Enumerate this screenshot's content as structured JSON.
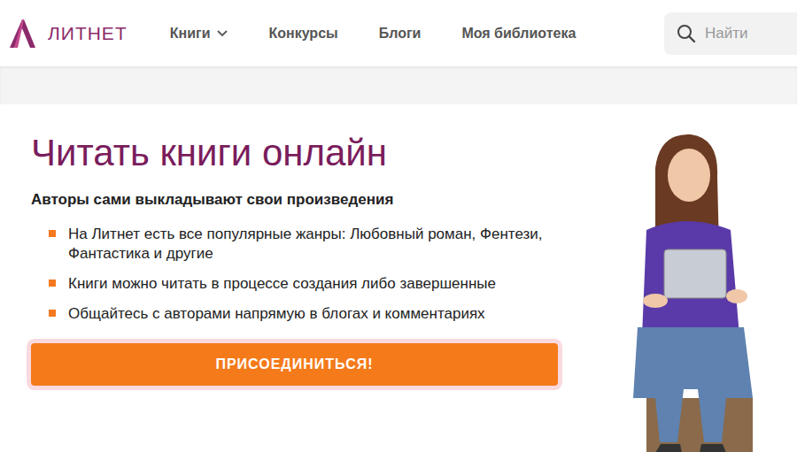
{
  "logo": {
    "text": "ЛИТНЕТ"
  },
  "nav": [
    {
      "label": "Книги",
      "dropdown": true
    },
    {
      "label": "Конкурсы",
      "dropdown": false
    },
    {
      "label": "Блоги",
      "dropdown": false
    },
    {
      "label": "Моя библиотека",
      "dropdown": false
    }
  ],
  "search": {
    "placeholder": "Найти"
  },
  "hero": {
    "title": "Читать книги онлайн",
    "subtitle": "Авторы сами выкладывают свои произведения",
    "bullets": [
      "На Литнет есть все популярные жанры: Любовный роман, Фентези, Фантастика и другие",
      "Книги можно читать в процессе создания либо завершенные",
      "Общайтесь с авторами напрямую в блогах и комментариях"
    ],
    "button": "ПРИСОЕДИНИТЬСЯ!"
  }
}
